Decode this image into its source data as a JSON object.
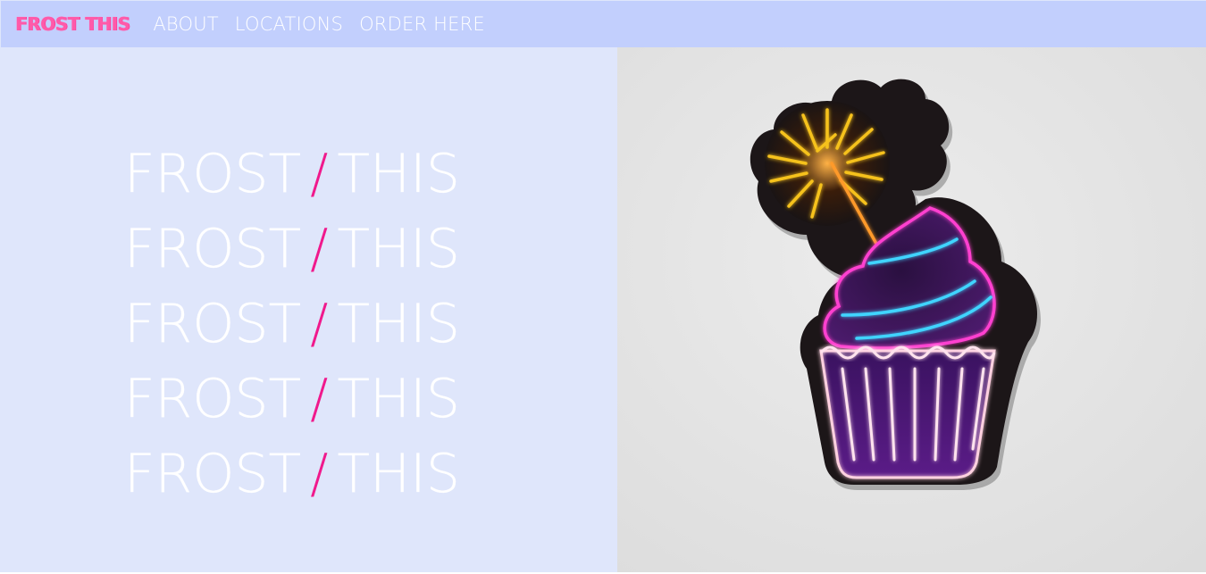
{
  "navbar": {
    "brand": "FROST THIS",
    "links": [
      "ABOUT",
      "LOCATIONS",
      "ORDER HERE"
    ]
  },
  "hero": {
    "lines": [
      {
        "left": "FROST",
        "sep": "/",
        "right": "THIS"
      },
      {
        "left": "FROST",
        "sep": "/",
        "right": "THIS"
      },
      {
        "left": "FROST",
        "sep": "/",
        "right": "THIS"
      },
      {
        "left": "FROST",
        "sep": "/",
        "right": "THIS"
      },
      {
        "left": "FROST",
        "sep": "/",
        "right": "THIS"
      }
    ]
  },
  "image": {
    "subject": "neon-cupcake-sticker-with-sparkler"
  },
  "colors": {
    "navbar_bg": "#c2cffd",
    "page_bg": "#dfe6fb",
    "brand_pink": "#ff5aa9",
    "slash_pink": "#f0198c",
    "photo_bg": "#e6e6e6"
  }
}
